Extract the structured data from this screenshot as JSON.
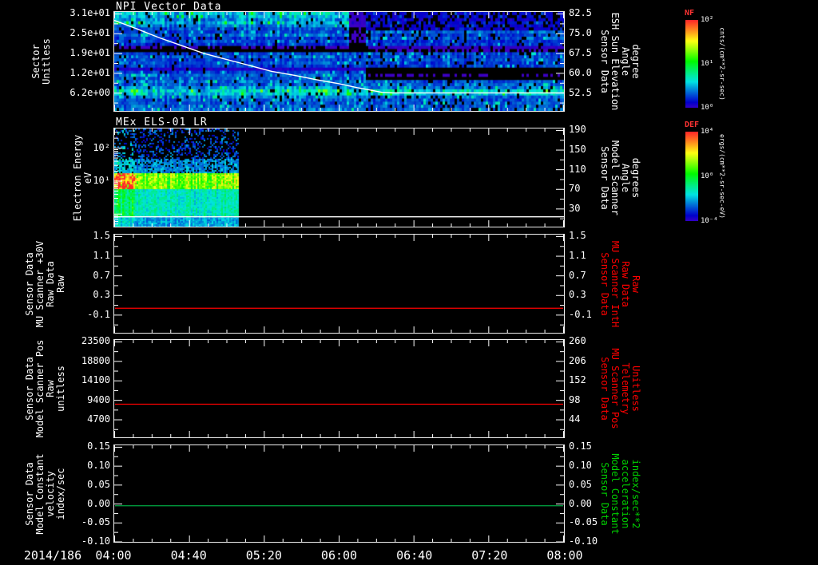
{
  "window": {
    "background": "#000000",
    "foreground": "#ffffff"
  },
  "x_axis": {
    "date_label": "2014/186",
    "tick_labels": [
      "04:00",
      "04:40",
      "05:20",
      "06:00",
      "06:40",
      "07:20",
      "08:00"
    ]
  },
  "colorbars": [
    {
      "name": "NF",
      "name_color": "#ff3333",
      "unit": "cnts/(cm**2-sr-sec)",
      "tick_labels": [
        "10²",
        "10¹",
        "10⁰"
      ]
    },
    {
      "name": "DEF",
      "name_color": "#ff3333",
      "unit": "ergs/(cm**2-sr-sec-eV)",
      "tick_labels": [
        "10⁴",
        "10⁰",
        "10⁻⁴"
      ]
    }
  ],
  "chart_data": [
    {
      "id": "npi-vector",
      "type": "heatmap",
      "title": "NPI Vector Data",
      "ylabel_lines": [
        "Sector",
        "Unitless"
      ],
      "y2label_lines": [
        "Sensor Data",
        "ESH Sun Elevation",
        "Angle",
        "degree"
      ],
      "y2label_color": "#ffffff",
      "yticks": [
        {
          "label": "3.1e+01",
          "frac": 0.02
        },
        {
          "label": "2.5e+01",
          "frac": 0.22
        },
        {
          "label": "1.9e+01",
          "frac": 0.42
        },
        {
          "label": "1.2e+01",
          "frac": 0.62
        },
        {
          "label": "6.2e+00",
          "frac": 0.82
        }
      ],
      "y2ticks": [
        {
          "label": "82.5",
          "frac": 0.02
        },
        {
          "label": "75.0",
          "frac": 0.22
        },
        {
          "label": "67.5",
          "frac": 0.42
        },
        {
          "label": "60.0",
          "frac": 0.62
        },
        {
          "label": "52.5",
          "frac": 0.82
        }
      ],
      "colorbar": "NF",
      "heatmap": {
        "rows_pre": [
          0.3,
          0.28,
          0.24,
          0.3,
          0.22,
          0.18,
          0.16,
          0.2,
          0.15,
          0.18,
          0.14,
          0.02,
          0.0,
          0.16,
          0.2,
          0.16,
          0.18,
          0.15,
          0.06,
          0.16,
          0.2,
          0.18,
          0.22,
          0.2,
          0.24,
          0.34,
          0.3,
          0.22,
          0.2,
          0.18,
          0.2,
          0.22
        ],
        "rows_post": [
          0.1,
          0.1,
          0.08,
          0.12,
          0.1,
          0.08,
          0.2,
          0.16,
          0.18,
          0.14,
          0.16,
          0.04,
          0.02,
          0.18,
          0.16,
          0.18,
          0.15,
          0.16,
          0.0,
          0.0,
          0.02,
          0.0,
          0.18,
          0.2,
          0.22,
          0.34,
          0.3,
          0.2,
          0.18,
          0.2,
          0.18,
          0.2
        ],
        "break_frac": 0.555,
        "note": "32-sector NPI count-rate spectrogram 04:00-08:00, counts ~10^0-10^2; black data-gap bands near sectors 19 and 12; reduced/speckled counts in top sectors after ~06:10; bright cyan band near sector 7"
      },
      "overlay_line": {
        "color": "#ffffff",
        "meaning": "ESH sun elevation angle decreasing from ~81 deg to ~54 deg, flat after ~06:20",
        "points": [
          [
            0,
            0.085
          ],
          [
            0.05,
            0.17
          ],
          [
            0.1,
            0.26
          ],
          [
            0.15,
            0.34
          ],
          [
            0.2,
            0.42
          ],
          [
            0.25,
            0.48
          ],
          [
            0.3,
            0.54
          ],
          [
            0.35,
            0.6
          ],
          [
            0.4,
            0.64
          ],
          [
            0.45,
            0.685
          ],
          [
            0.5,
            0.725
          ],
          [
            0.54,
            0.765
          ],
          [
            0.57,
            0.79
          ],
          [
            0.595,
            0.812
          ],
          [
            0.62,
            0.818
          ],
          [
            1,
            0.818
          ]
        ]
      }
    },
    {
      "id": "mex-els",
      "type": "heatmap",
      "title": "MEx ELS-01 LR",
      "ylabel_lines": [
        "Electron Energy",
        "eV"
      ],
      "y2label_lines": [
        "Sensor Data",
        "Model Scanner",
        "Angle",
        "degrees"
      ],
      "y2label_color": "#ffffff",
      "yticks": [
        {
          "label": "10²",
          "frac": 0.2
        },
        {
          "label": "10¹",
          "frac": 0.536
        }
      ],
      "log_axis": {
        "decade_frac_10e2": 0.2,
        "frac_per_decade": 0.336
      },
      "y2ticks": [
        {
          "label": "190",
          "frac": 0.02
        },
        {
          "label": "150",
          "frac": 0.22
        },
        {
          "label": "110",
          "frac": 0.42
        },
        {
          "label": "70",
          "frac": 0.62
        },
        {
          "label": "30",
          "frac": 0.82
        }
      ],
      "colorbar": "DEF",
      "heatmap": {
        "data_end_frac": 0.275,
        "band_center_frac": 0.53,
        "band_halfwidth_frac": 0.08,
        "note": "Electron energy flux present only 04:00-~05:05; enhanced green/yellow band near ~10 eV, hottest (orange) right at 04:00; cyan below band, sparse blue speckle above; no data afterwards (black)"
      },
      "overlay_line": {
        "color": "#ffffff",
        "points": [
          [
            0,
            0.9
          ],
          [
            1,
            0.9
          ]
        ]
      }
    },
    {
      "id": "mu-scanner-30v",
      "type": "line",
      "ylabel_lines": [
        "Sensor Data",
        "MU Scanner +30V",
        "Raw Data",
        "Raw"
      ],
      "y2label_lines": [
        "Sensor Data",
        "MU Scanner IntH",
        "Raw Data",
        "Raw"
      ],
      "y2label_color": "#ff0000",
      "ylim": [
        -0.5,
        1.5
      ],
      "yticks": [
        {
          "label": "1.5",
          "frac": 0.02
        },
        {
          "label": "1.1",
          "frac": 0.22
        },
        {
          "label": "0.7",
          "frac": 0.42
        },
        {
          "label": "0.3",
          "frac": 0.62
        },
        {
          "label": "-0.1",
          "frac": 0.82
        }
      ],
      "y2ticks": [
        {
          "label": "1.5",
          "frac": 0.02
        },
        {
          "label": "1.1",
          "frac": 0.22
        },
        {
          "label": "0.7",
          "frac": 0.42
        },
        {
          "label": "0.3",
          "frac": 0.62
        },
        {
          "label": "-0.1",
          "frac": 0.82
        }
      ],
      "series": [
        {
          "name": "MU Scanner IntH Raw",
          "color": "#ff0000",
          "constant_value": 0.0,
          "frac": 0.75
        }
      ]
    },
    {
      "id": "model-scanner-pos",
      "type": "line",
      "ylabel_lines": [
        "Sensor Data",
        "Model Scanner Pos",
        "Raw",
        "unitless"
      ],
      "y2label_lines": [
        "Sensor Data",
        "MU Scanner Pos",
        "Telemetry",
        "Unitless"
      ],
      "y2label_color": "#ff0000",
      "ylim": [
        0,
        23500
      ],
      "yticks": [
        {
          "label": "23500",
          "frac": 0.02
        },
        {
          "label": "18800",
          "frac": 0.22
        },
        {
          "label": "14100",
          "frac": 0.42
        },
        {
          "label": "9400",
          "frac": 0.62
        },
        {
          "label": "4700",
          "frac": 0.82
        }
      ],
      "y2ticks": [
        {
          "label": "260",
          "frac": 0.02
        },
        {
          "label": "206",
          "frac": 0.22
        },
        {
          "label": "152",
          "frac": 0.42
        },
        {
          "label": "98",
          "frac": 0.62
        },
        {
          "label": "44",
          "frac": 0.82
        }
      ],
      "series": [
        {
          "name": "Scanner position",
          "color": "#ff0000",
          "constant_value": 8500,
          "frac": 0.66
        }
      ]
    },
    {
      "id": "model-constant",
      "type": "line",
      "ylabel_lines": [
        "Sensor Data",
        "Model Constant",
        "velocity",
        "index/sec"
      ],
      "y2label_lines": [
        "Sensor Data",
        "Model Constant",
        "acceleration",
        "index/sec**2"
      ],
      "y2label_color": "#00d000",
      "ylim": [
        -0.1,
        0.15
      ],
      "yticks": [
        {
          "label": "0.15",
          "frac": 0.02
        },
        {
          "label": "0.10",
          "frac": 0.216
        },
        {
          "label": "0.05",
          "frac": 0.412
        },
        {
          "label": "0.00",
          "frac": 0.608
        },
        {
          "label": "-0.05",
          "frac": 0.804
        },
        {
          "label": "-0.10",
          "frac": 1.0
        }
      ],
      "y2ticks": [
        {
          "label": "0.15",
          "frac": 0.02
        },
        {
          "label": "0.10",
          "frac": 0.216
        },
        {
          "label": "0.05",
          "frac": 0.412
        },
        {
          "label": "0.00",
          "frac": 0.608
        },
        {
          "label": "-0.05",
          "frac": 0.804
        },
        {
          "label": "-0.10",
          "frac": 1.0
        }
      ],
      "series": [
        {
          "name": "Model constant velocity",
          "color": "#00a843",
          "constant_value": 0.0,
          "frac": 0.626
        }
      ]
    }
  ]
}
